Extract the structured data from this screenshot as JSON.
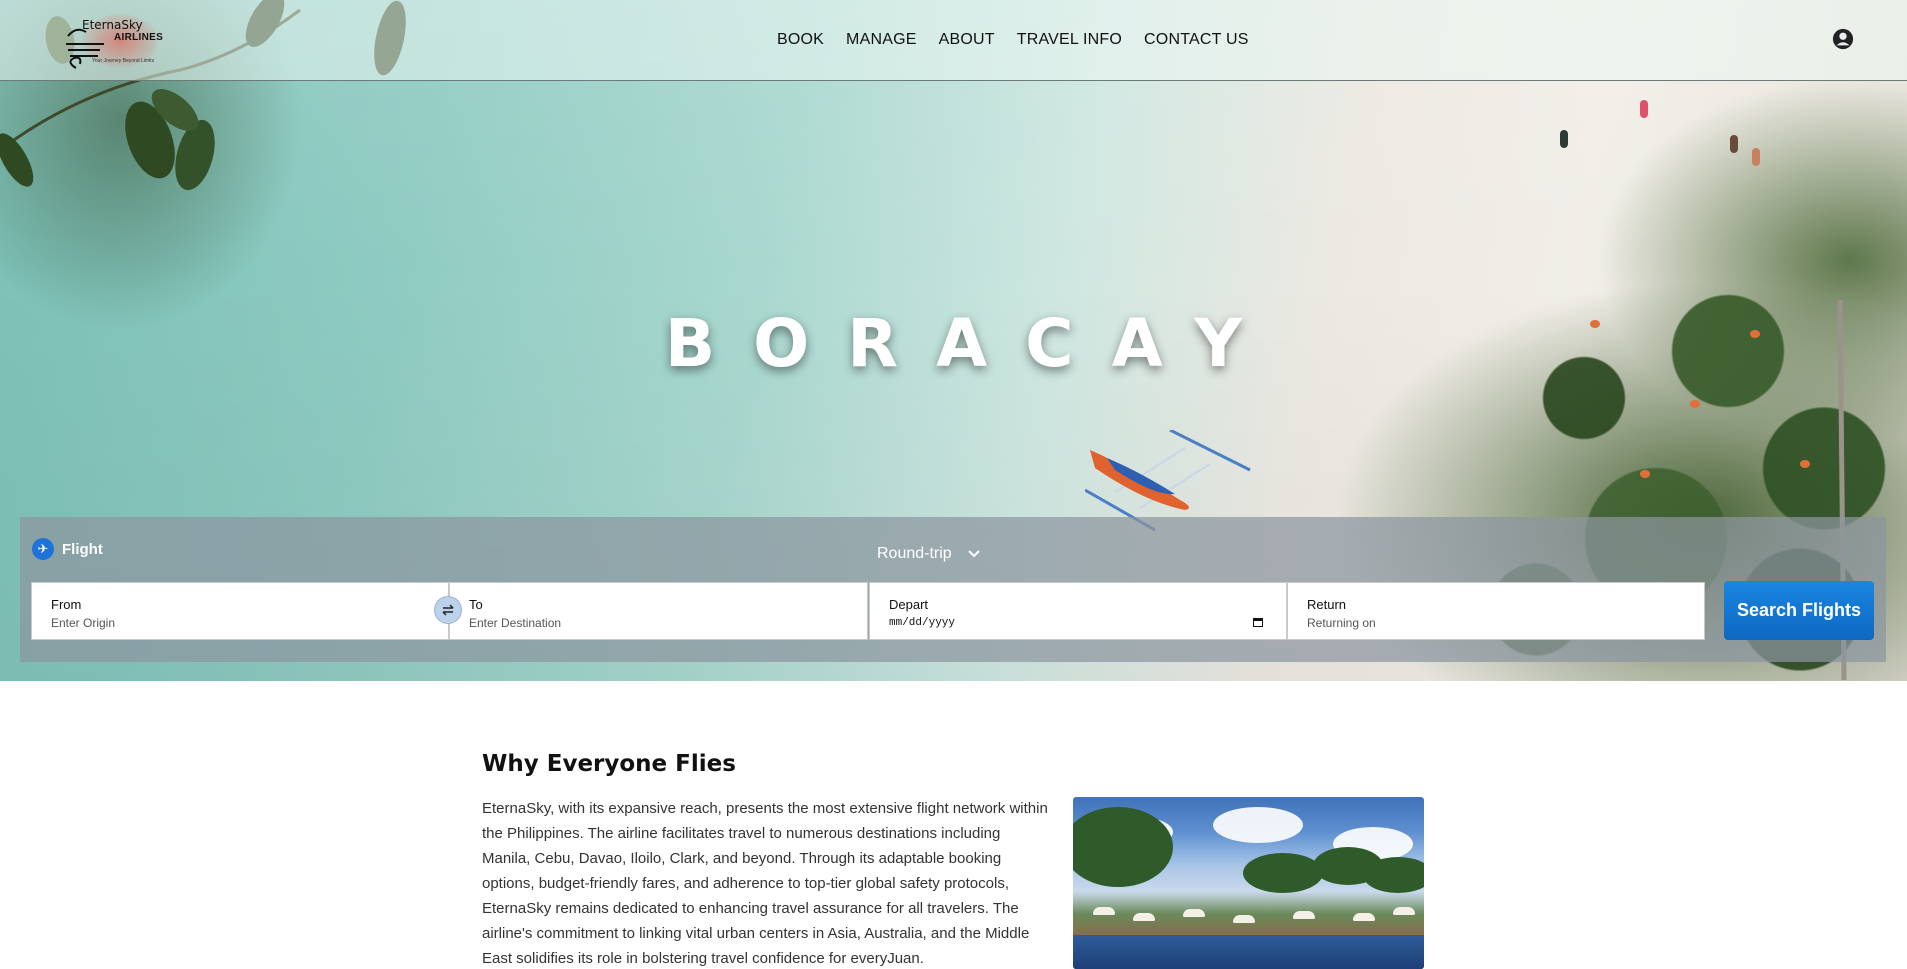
{
  "brand": {
    "name": "EternaSky",
    "airlines": "AIRLINES",
    "tagline": "Your Journey Beyond Limits"
  },
  "nav": {
    "items": [
      {
        "label": "BOOK"
      },
      {
        "label": "MANAGE"
      },
      {
        "label": "ABOUT"
      },
      {
        "label": "TRAVEL INFO"
      },
      {
        "label": "CONTACT US"
      }
    ],
    "account_icon": "user-circle-icon"
  },
  "hero": {
    "title": "BORACAY"
  },
  "search": {
    "tab_label": "Flight",
    "tab_icon": "airplane-icon",
    "trip_type": "Round-trip",
    "from_label": "From",
    "from_placeholder": "Enter Origin",
    "to_label": "To",
    "to_placeholder": "Enter Destination",
    "depart_label": "Depart",
    "depart_value": "mm/dd/yyyy",
    "return_label": "Return",
    "return_placeholder": "Returning on",
    "button_label": "Search Flights",
    "button_color": "#1a7ed6"
  },
  "about": {
    "title": "Why Everyone Flies",
    "body": "EternaSky, with its expansive reach, presents the most extensive flight network within the Philippines. The airline facilitates travel to numerous destinations including Manila, Cebu, Davao, Iloilo, Clark, and beyond. Through its adaptable booking options, budget-friendly fares, and adherence to top-tier global safety protocols, EternaSky remains dedicated to enhancing travel assurance for all travelers. The airline's commitment to linking vital urban centers in Asia, Australia, and the Middle East solidifies its role in bolstering travel confidence for everyJuan."
  }
}
